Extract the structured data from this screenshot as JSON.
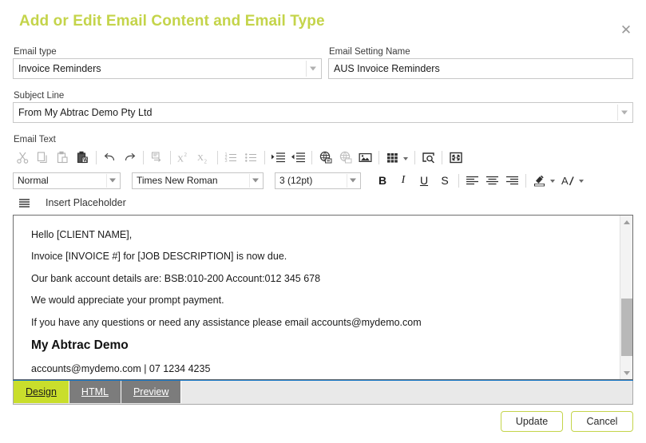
{
  "dialog": {
    "title": "Add or Edit Email Content and Email Type",
    "close_label": "✕",
    "accent_color": "#c4d44a",
    "tab_active_color": "#c9de2c",
    "tab_inactive_color": "#7c7c7c",
    "editor_rule_color": "#1273c4"
  },
  "fields": {
    "email_type": {
      "label": "Email type",
      "value": "Invoice Reminders"
    },
    "setting_name": {
      "label": "Email Setting Name",
      "value": "AUS Invoice Reminders"
    },
    "subject_line": {
      "label": "Subject Line",
      "value": "From My Abtrac Demo Pty Ltd"
    },
    "email_text": {
      "label": "Email Text"
    }
  },
  "toolbar": {
    "row1_icons": [
      "cut-icon",
      "copy-icon",
      "paste-icon",
      "paste-word-icon",
      "undo-icon",
      "redo-icon",
      "paste-text-icon",
      "superscript-icon",
      "subscript-icon",
      "ordered-list-icon",
      "unordered-list-icon",
      "indent-increase-icon",
      "indent-decrease-icon",
      "insert-link-icon",
      "remove-link-icon",
      "insert-image-icon",
      "insert-table-icon",
      "find-replace-icon",
      "fullscreen-icon"
    ],
    "style_select": {
      "name": "paragraph-style-select",
      "value": "Normal"
    },
    "font_select": {
      "name": "font-family-select",
      "value": "Times New Roman"
    },
    "size_select": {
      "name": "font-size-select",
      "value": "3 (12pt)"
    },
    "bold_label": "B",
    "italic_label": "I",
    "underline_label": "U",
    "strike_label": "S",
    "align_left_icon": "align-left-icon",
    "align_center_icon": "align-center-icon",
    "align_right_icon": "align-right-icon",
    "highlight_icon": "text-highlight-icon",
    "forecolor_icon": "font-color-icon",
    "placeholder_icon": "list-lines-icon",
    "placeholder_label": "Insert Placeholder"
  },
  "email_body": {
    "lines": [
      "Hello [CLIENT NAME],",
      "Invoice [INVOICE #] for [JOB DESCRIPTION] is now due.",
      "Our bank account details are: BSB:010-200 Account:012 345 678",
      "We would appreciate your prompt payment.",
      "If you have any questions or need any assistance please email accounts@mydemo.com"
    ],
    "signature_name": "My Abtrac Demo",
    "signature_contact": "accounts@mydemo.com | 07 1234 4235"
  },
  "tabs": [
    {
      "label": "Design",
      "active": true
    },
    {
      "label": "HTML",
      "active": false
    },
    {
      "label": "Preview",
      "active": false
    }
  ],
  "footer": {
    "update_label": "Update",
    "cancel_label": "Cancel"
  }
}
